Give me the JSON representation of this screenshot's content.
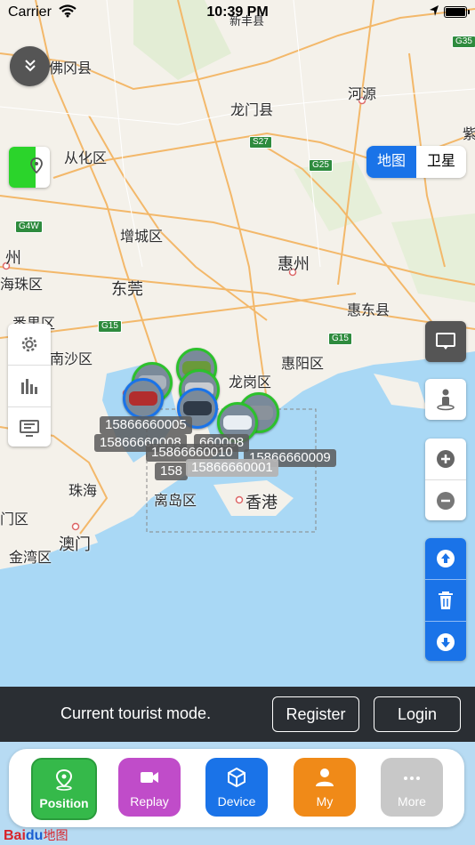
{
  "status_bar": {
    "carrier": "Carrier",
    "time": "10:39 PM"
  },
  "map": {
    "place_labels": [
      {
        "id": "fogang",
        "text": "佛冈县"
      },
      {
        "id": "heyuan",
        "text": "河源"
      },
      {
        "id": "longmen",
        "text": "龙门县"
      },
      {
        "id": "conghua",
        "text": "从化区"
      },
      {
        "id": "zengcheng",
        "text": "增城区"
      },
      {
        "id": "huizhou",
        "text": "惠州"
      },
      {
        "id": "dongguan",
        "text": "东莞"
      },
      {
        "id": "panyu",
        "text": "番禺区"
      },
      {
        "id": "huidong",
        "text": "惠东县"
      },
      {
        "id": "nansha",
        "text": "南沙区"
      },
      {
        "id": "longgang",
        "text": "龙岗区"
      },
      {
        "id": "huiyang",
        "text": "惠阳区"
      },
      {
        "id": "zhuhai",
        "text": "珠海"
      },
      {
        "id": "xiangang",
        "text": "香港"
      },
      {
        "id": "lidao",
        "text": "离岛区"
      },
      {
        "id": "macau",
        "text": "澳门"
      },
      {
        "id": "jinwan",
        "text": "金湾区"
      },
      {
        "id": "haizhu",
        "text": "海珠区"
      },
      {
        "id": "guangzhou",
        "text": "州"
      },
      {
        "id": "menqu",
        "text": "门区"
      },
      {
        "id": "zi",
        "text": "紫"
      },
      {
        "id": "xinfeng",
        "text": "新丰县"
      }
    ],
    "highway_labels": [
      "G35",
      "S27",
      "G25",
      "G4W",
      "G15",
      "G15"
    ],
    "map_type": {
      "standard": "地图",
      "satellite": "卫星"
    }
  },
  "device_labels": [
    "15866660005",
    "15866660008",
    "15866660010",
    "15866660009",
    "158",
    "15866660001",
    "660008"
  ],
  "banner": {
    "message": "Current tourist mode.",
    "register": "Register",
    "login": "Login"
  },
  "tabs": {
    "position": "Position",
    "replay": "Replay",
    "device": "Device",
    "my": "My",
    "more": "More"
  },
  "branding": {
    "baidu_a": "Bai",
    "baidu_b": "du",
    "baidu_c": "地图"
  },
  "colors": {
    "accent": "#1a73e8",
    "green": "#35b94a",
    "purple": "#c04cc9",
    "orange": "#f08a18",
    "gray": "#c8c8c8",
    "banner": "#2a2e33"
  }
}
